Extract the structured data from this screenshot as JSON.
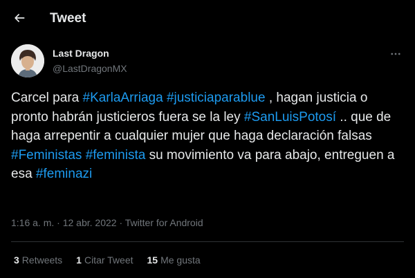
{
  "header": {
    "title": "Tweet"
  },
  "author": {
    "display_name": "Last Dragon",
    "handle": "@LastDragonMX"
  },
  "tweet": {
    "segments": [
      {
        "text": "Carcel para ",
        "hashtag": false
      },
      {
        "text": "#KarlaArriaga",
        "hashtag": true
      },
      {
        "text": " ",
        "hashtag": false
      },
      {
        "text": "#justiciaparablue",
        "hashtag": true
      },
      {
        "text": " , hagan justicia o pronto habrán justicieros fuera se la ley ",
        "hashtag": false
      },
      {
        "text": "#SanLuisPotosí",
        "hashtag": true
      },
      {
        "text": " .. que de haga arrepentir a cualquier mujer que haga declaración falsas ",
        "hashtag": false
      },
      {
        "text": "#Feministas",
        "hashtag": true
      },
      {
        "text": " ",
        "hashtag": false
      },
      {
        "text": "#feminista",
        "hashtag": true
      },
      {
        "text": " su movimiento va para abajo,  entreguen a esa ",
        "hashtag": false
      },
      {
        "text": "#feminazi",
        "hashtag": true
      }
    ]
  },
  "meta": {
    "time": "1:16 a. m.",
    "separator": "·",
    "date": "12 abr. 2022",
    "source": "Twitter for Android"
  },
  "stats": {
    "retweets": {
      "count": "3",
      "label": "Retweets"
    },
    "quotes": {
      "count": "1",
      "label": "Citar Tweet"
    },
    "likes": {
      "count": "15",
      "label": "Me gusta"
    }
  },
  "colors": {
    "background": "#000000",
    "text": "#e7e9ea",
    "muted": "#71767b",
    "link": "#1d9bf0",
    "divider": "#2f3336"
  },
  "icons": {
    "back": "arrow-left-icon",
    "more": "more-horizontal-icon"
  }
}
